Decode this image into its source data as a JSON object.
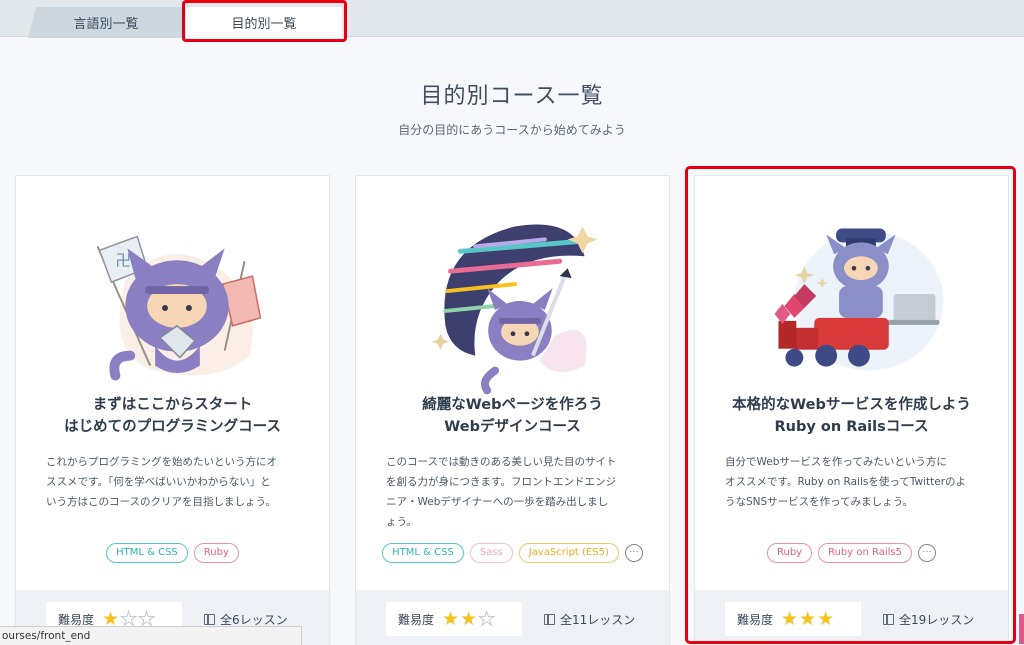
{
  "tabs": [
    {
      "label": "言語別一覧"
    },
    {
      "label": "目的別一覧"
    }
  ],
  "page": {
    "title": "目的別コース一覧",
    "subtitle": "自分の目的にあうコースから始めてみよう"
  },
  "cards": [
    {
      "title_line1": "まずはここからスタート",
      "title_line2": "はじめてのプログラミングコース",
      "desc_lines": [
        "これからプログラミングを始めたいという方にオ",
        "ススメです。「何を学べばいいかわからない」と",
        "いう方はこのコースのクリアを目指しましょう。"
      ],
      "tags": [
        "HTML & CSS",
        "Ruby"
      ],
      "difficulty_label": "難易度",
      "difficulty": 1,
      "lessons": "全6レッスン"
    },
    {
      "title_line1": "綺麗なWebページを作ろう",
      "title_line2": "Webデザインコース",
      "desc_lines": [
        "このコースでは動きのある美しい見た目のサイト",
        "を創る力が身につきます。フロントエンドエンジ",
        "ニア・Webデザイナーへの一歩を踏み出しまし",
        "ょう。"
      ],
      "tags": [
        "HTML & CSS",
        "Sass",
        "JavaScript (ES5)"
      ],
      "more": "···",
      "difficulty_label": "難易度",
      "difficulty": 2,
      "lessons": "全11レッスン"
    },
    {
      "title_line1": "本格的なWebサービスを作成しよう",
      "title_line2": "Ruby on Railsコース",
      "desc_lines": [
        "自分でWebサービスを作ってみたいという方に",
        "オススメです。Ruby on Railsを使ってTwitterのよ",
        "うなSNSサービスを作ってみましょう。"
      ],
      "tags": [
        "Ruby",
        "Ruby on Rails5"
      ],
      "more": "···",
      "difficulty_label": "難易度",
      "difficulty": 3,
      "lessons": "全19レッスン"
    }
  ],
  "status_url": "ourses/front_end",
  "colors": {
    "highlight": "#e60012",
    "star": "#f6c21c",
    "ninja_purple": "#8b7fc3"
  }
}
